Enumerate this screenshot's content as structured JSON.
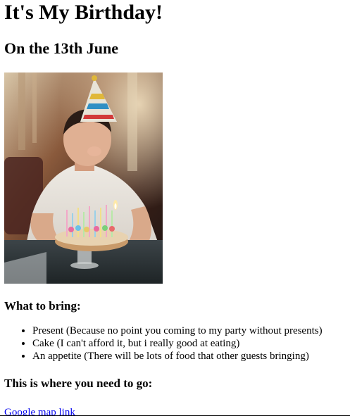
{
  "title": "It's My Birthday!",
  "subtitle": "On the 13th June",
  "bring_heading": "What to bring:",
  "bring_items": [
    "Present (Because no point you coming to my party without presents)",
    "Cake (I can't afford it, but i really good at eating)",
    "An appetite (There will be lots of food that other guests bringing)"
  ],
  "where_heading": "This is where you need to go:",
  "map_link_label": "Google map link",
  "colors": {
    "link": "#0000ee",
    "text": "#000000"
  }
}
